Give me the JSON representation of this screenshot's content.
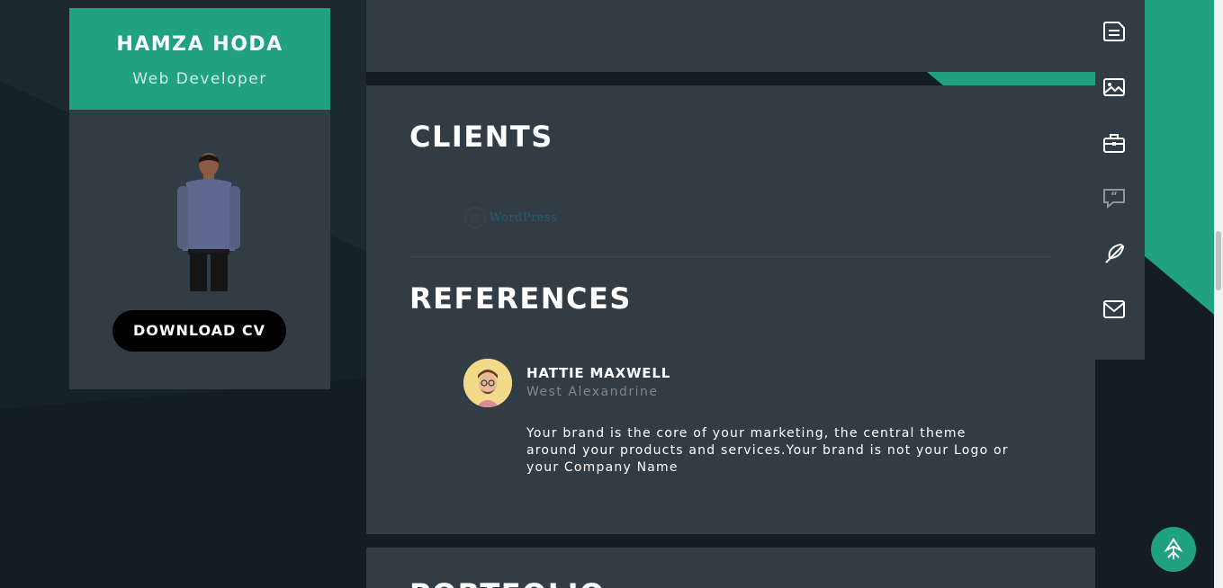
{
  "profile": {
    "name": "HAMZA HODA",
    "role": "Web Developer",
    "download_label": "DOWNLOAD CV"
  },
  "sections": {
    "clients_title": "CLIENTS",
    "references_title": "REFERENCES",
    "next_title": "PORTFOLIO"
  },
  "clients": [
    {
      "name": "WordPress",
      "logo_text": "WordPress"
    }
  ],
  "references": [
    {
      "name": "HATTIE MAXWELL",
      "location": "West Alexandrine",
      "quote": "Your brand is the core of your marketing, the central theme around your products and services.Your brand is not your Logo or your Company Name"
    }
  ],
  "nav": [
    {
      "icon": "resume-icon"
    },
    {
      "icon": "image-icon"
    },
    {
      "icon": "briefcase-icon"
    },
    {
      "icon": "quote-bubble-icon"
    },
    {
      "icon": "feather-icon"
    },
    {
      "icon": "mail-icon"
    }
  ],
  "colors": {
    "accent": "#1fa182",
    "panel": "#323c44",
    "background": "#141d24"
  }
}
